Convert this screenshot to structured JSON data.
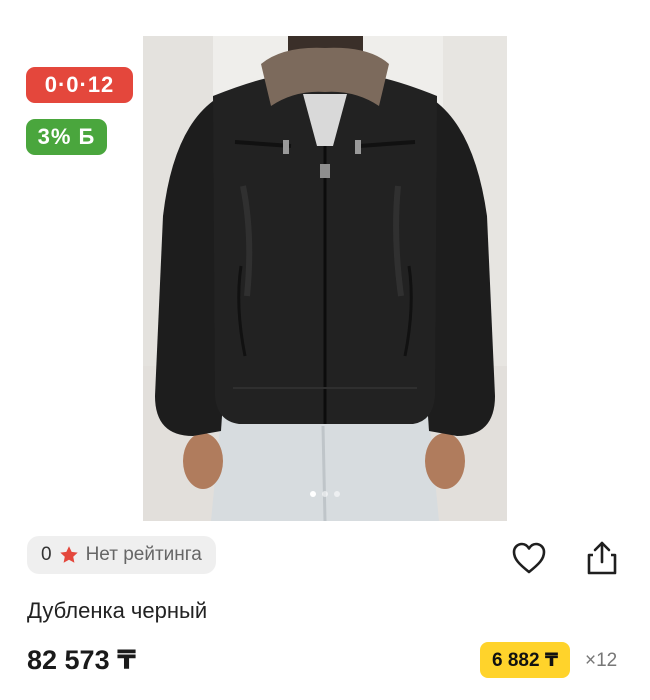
{
  "product": {
    "installment_badge": "0·0·12",
    "bonus_badge": "3% Б",
    "rating_count": "0",
    "rating_text": "Нет рейтинга",
    "title": "Дубленка черный",
    "price": "82 573 ₸",
    "monthly_payment": "6 882 ₸",
    "months": "×12"
  },
  "gallery": {
    "image_count": 3,
    "active_index": 0
  },
  "icons": {
    "favorite": "heart-icon",
    "share": "share-icon",
    "rating": "star-icon"
  },
  "colors": {
    "installment_badge": "#e4473c",
    "bonus_badge": "#4aa63d",
    "monthly_highlight": "#ffd32b",
    "star": "#e4473c"
  }
}
